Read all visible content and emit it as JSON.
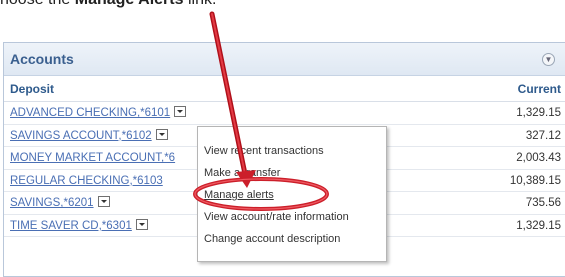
{
  "instruction": {
    "text_before": "hoose the ",
    "bold": "Manage Alerts",
    "text_after": " link."
  },
  "panel": {
    "title": "Accounts",
    "collapse_icon": "collapse-circle-icon"
  },
  "columns": {
    "deposit": "Deposit",
    "current": "Current"
  },
  "accounts": [
    {
      "name": "ADVANCED CHECKING,*6101",
      "amount": "1,329.15"
    },
    {
      "name": "SAVINGS ACCOUNT,*6102",
      "amount": "327.12"
    },
    {
      "name": "MONEY MARKET ACCOUNT,*6",
      "amount": "2,003.43"
    },
    {
      "name": "REGULAR CHECKING,*6103",
      "amount": "10,389.15"
    },
    {
      "name": "SAVINGS,*6201",
      "amount": "735.56"
    },
    {
      "name": "TIME SAVER CD,*6301",
      "amount": "1,329.15"
    }
  ],
  "context_menu": {
    "items": [
      "View recent transactions",
      "Make a transfer",
      "Manage alerts",
      "View account/rate information",
      "Change account description"
    ]
  },
  "colors": {
    "highlight_ring": "#cc1f2a",
    "link": "#4a6fb4",
    "header_text": "#2e5a8c"
  }
}
